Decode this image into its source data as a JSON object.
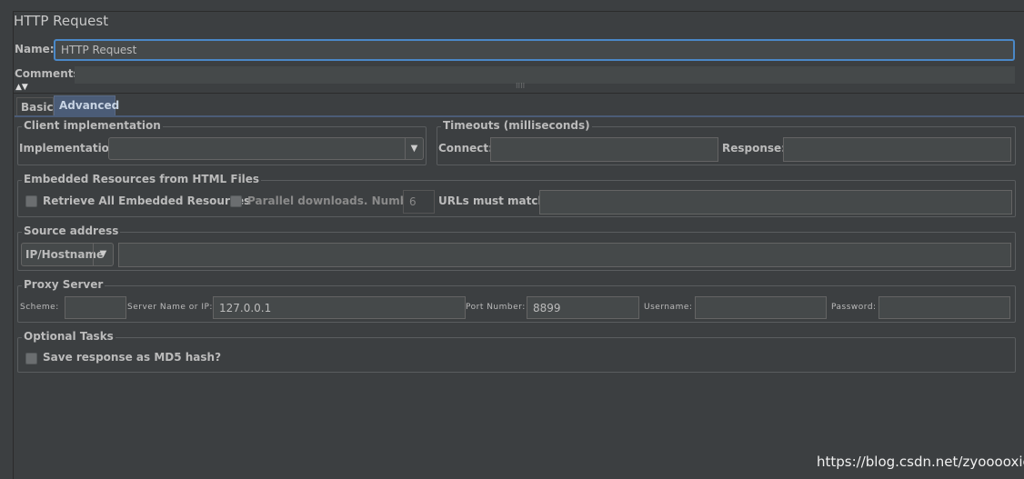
{
  "title": "HTTP Request",
  "name": {
    "label": "Name:",
    "value": "HTTP Request"
  },
  "comments": {
    "label": "Comments:",
    "value": ""
  },
  "tabs": [
    {
      "label": "Basic",
      "selected": false
    },
    {
      "label": "Advanced",
      "selected": true
    }
  ],
  "client": {
    "title": "Client implementation",
    "impl_label": "Implementation:",
    "impl_value": ""
  },
  "timeouts": {
    "title": "Timeouts (milliseconds)",
    "connect_label": "Connect:",
    "connect_value": "",
    "response_label": "Response:",
    "response_value": ""
  },
  "embedded": {
    "title": "Embedded Resources from HTML Files",
    "retrieve_label": "Retrieve All Embedded Resources",
    "retrieve_checked": false,
    "parallel_label": "Parallel downloads. Number:",
    "parallel_checked": false,
    "parallel_number": "6",
    "urls_label": "URLs must match:",
    "urls_value": ""
  },
  "source": {
    "title": "Source address",
    "type_value": "IP/Hostname",
    "address_value": ""
  },
  "proxy": {
    "title": "Proxy Server",
    "scheme_label": "Scheme:",
    "scheme_value": "",
    "server_label": "Server Name or IP:",
    "server_value": "127.0.0.1",
    "port_label": "Port Number:",
    "port_value": "8899",
    "username_label": "Username:",
    "username_value": "",
    "password_label": "Password:",
    "password_value": ""
  },
  "optional": {
    "title": "Optional Tasks",
    "md5_label": "Save response as MD5 hash?",
    "md5_checked": false
  },
  "watermark": "https://blog.csdn.net/zyooooxie",
  "colors": {
    "background": "#3c3f41",
    "field": "#45494a",
    "focus": "#4a88c7",
    "tab_selected": "#4b5c77"
  }
}
